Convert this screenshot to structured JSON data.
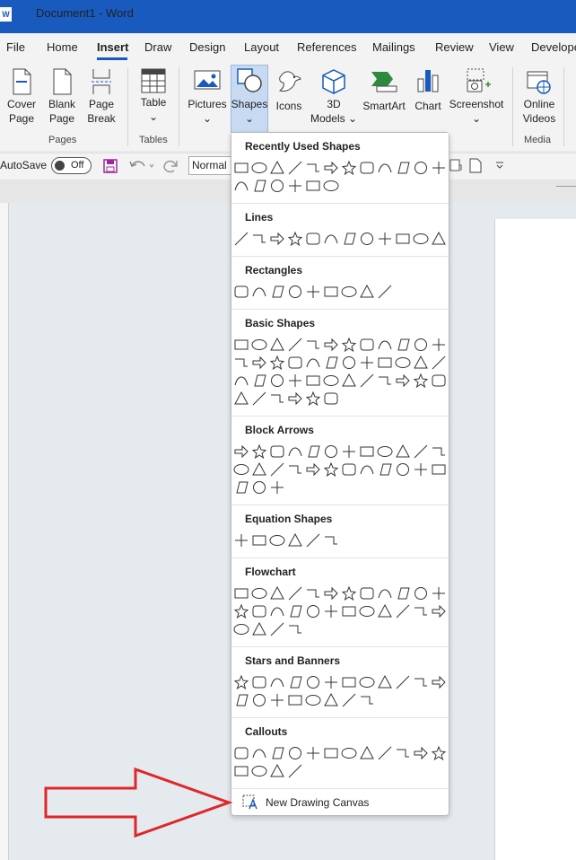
{
  "titlebar": {
    "app_badge": "W",
    "title": "Document1 - Word"
  },
  "tabs": [
    "File",
    "Home",
    "Insert",
    "Draw",
    "Design",
    "Layout",
    "References",
    "Mailings",
    "Review",
    "View",
    "Develope"
  ],
  "active_tab": "Insert",
  "ribbon": {
    "buttons": {
      "cover_page": [
        "Cover",
        "Page"
      ],
      "blank_page": [
        "Blank",
        "Page"
      ],
      "page_break": [
        "Page",
        "Break"
      ],
      "table": [
        "Table"
      ],
      "pictures": [
        "Pictures"
      ],
      "shapes": [
        "Shapes"
      ],
      "icons": [
        "Icons"
      ],
      "models_3d": [
        "3D",
        "Models"
      ],
      "smartart": [
        "SmartArt"
      ],
      "chart": [
        "Chart"
      ],
      "screenshot": [
        "Screenshot"
      ],
      "online_videos": [
        "Online",
        "Videos"
      ]
    },
    "groups": {
      "pages": "Pages",
      "tables": "Tables",
      "media": "Media"
    }
  },
  "quick_access": {
    "autosave_label": "AutoSave",
    "autosave_state": "Off",
    "style_value": "Normal"
  },
  "shapes_menu": {
    "sections": {
      "recently_used": "Recently Used Shapes",
      "lines": "Lines",
      "rectangles": "Rectangles",
      "basic_shapes": "Basic Shapes",
      "block_arrows": "Block Arrows",
      "equation_shapes": "Equation Shapes",
      "flowchart": "Flowchart",
      "stars_banners": "Stars and Banners",
      "callouts": "Callouts"
    },
    "new_drawing_canvas": "New Drawing Canvas"
  },
  "colors": {
    "accent": "#185abd",
    "annotation_arrow": "#e0262a"
  }
}
